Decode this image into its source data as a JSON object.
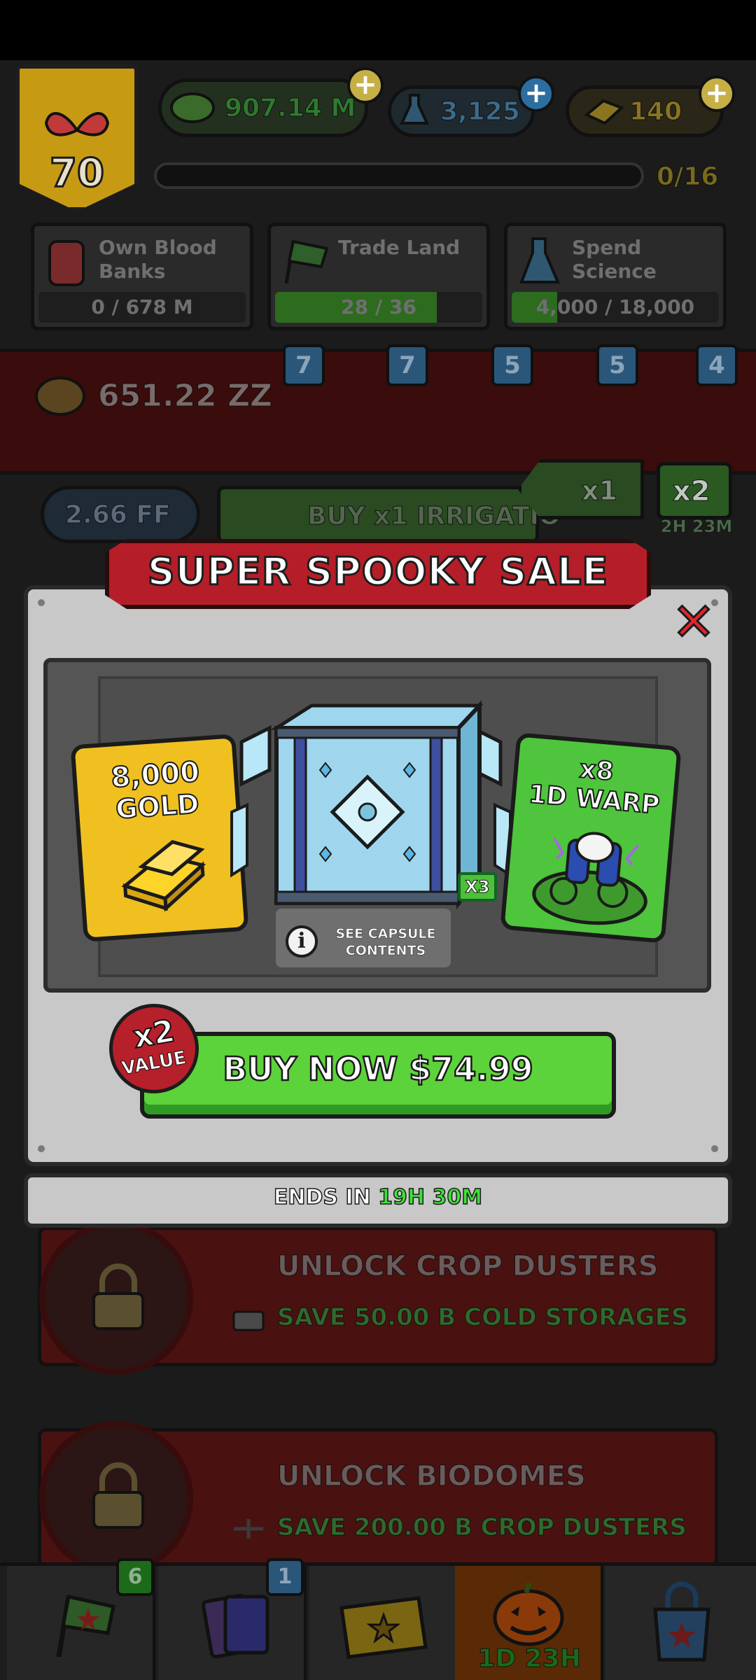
{
  "status_bar": {},
  "top_bar": {
    "level": "70",
    "cash": "907.14 M",
    "science": "3,125",
    "gold": "140",
    "level_progress": "0/16"
  },
  "quests": [
    {
      "title": "Own Blood Banks",
      "progress": "0 / 678 M",
      "fill": 0.0
    },
    {
      "title": "Trade Land",
      "progress": "28 / 36",
      "fill": 0.78
    },
    {
      "title": "Spend Science",
      "progress": "4,000 / 18,000",
      "fill": 0.22
    }
  ],
  "farm_row": {
    "value": "651.22 ZZ",
    "badges": [
      "7",
      "7",
      "5",
      "5",
      "4"
    ]
  },
  "buy_row": {
    "cost": "2.66 FF",
    "label": "BUY x1 IRRIGATIO",
    "multiplier": "x1",
    "boost": "x2",
    "boost_timer": "2H 23M"
  },
  "modal": {
    "title": "SUPER SPOOKY SALE",
    "close_icon": "close-x-icon",
    "gold_card": {
      "amount": "8,000",
      "label": "GOLD"
    },
    "warp_card": {
      "count": "x8",
      "label": "1D WARP"
    },
    "chest_count": "X3",
    "see_contents": "SEE CAPSULE CONTENTS",
    "value_badge": {
      "multiplier": "x2",
      "label": "VALUE"
    },
    "buy_button": "BUY NOW $74.99",
    "ends_label": "ENDS IN",
    "ends_hours": "19H",
    "ends_minutes": "30M"
  },
  "unlock_cards": [
    {
      "title": "UNLOCK CROP DUSTERS",
      "subtitle": "SAVE 50.00 B COLD STORAGES"
    },
    {
      "title": "UNLOCK BIODOMES",
      "subtitle": "SAVE 200.00 B CROP DUSTERS"
    }
  ],
  "bottom_nav": {
    "flag_badge": "6",
    "cards_badge": "1",
    "event_timer": "1D 23H"
  },
  "colors": {
    "buy_green": "#5cd33a",
    "ribbon_red": "#b51e28",
    "gold_card": "#f0c021",
    "warp_card": "#4ec53c",
    "timer_green": "#3fe03a"
  }
}
